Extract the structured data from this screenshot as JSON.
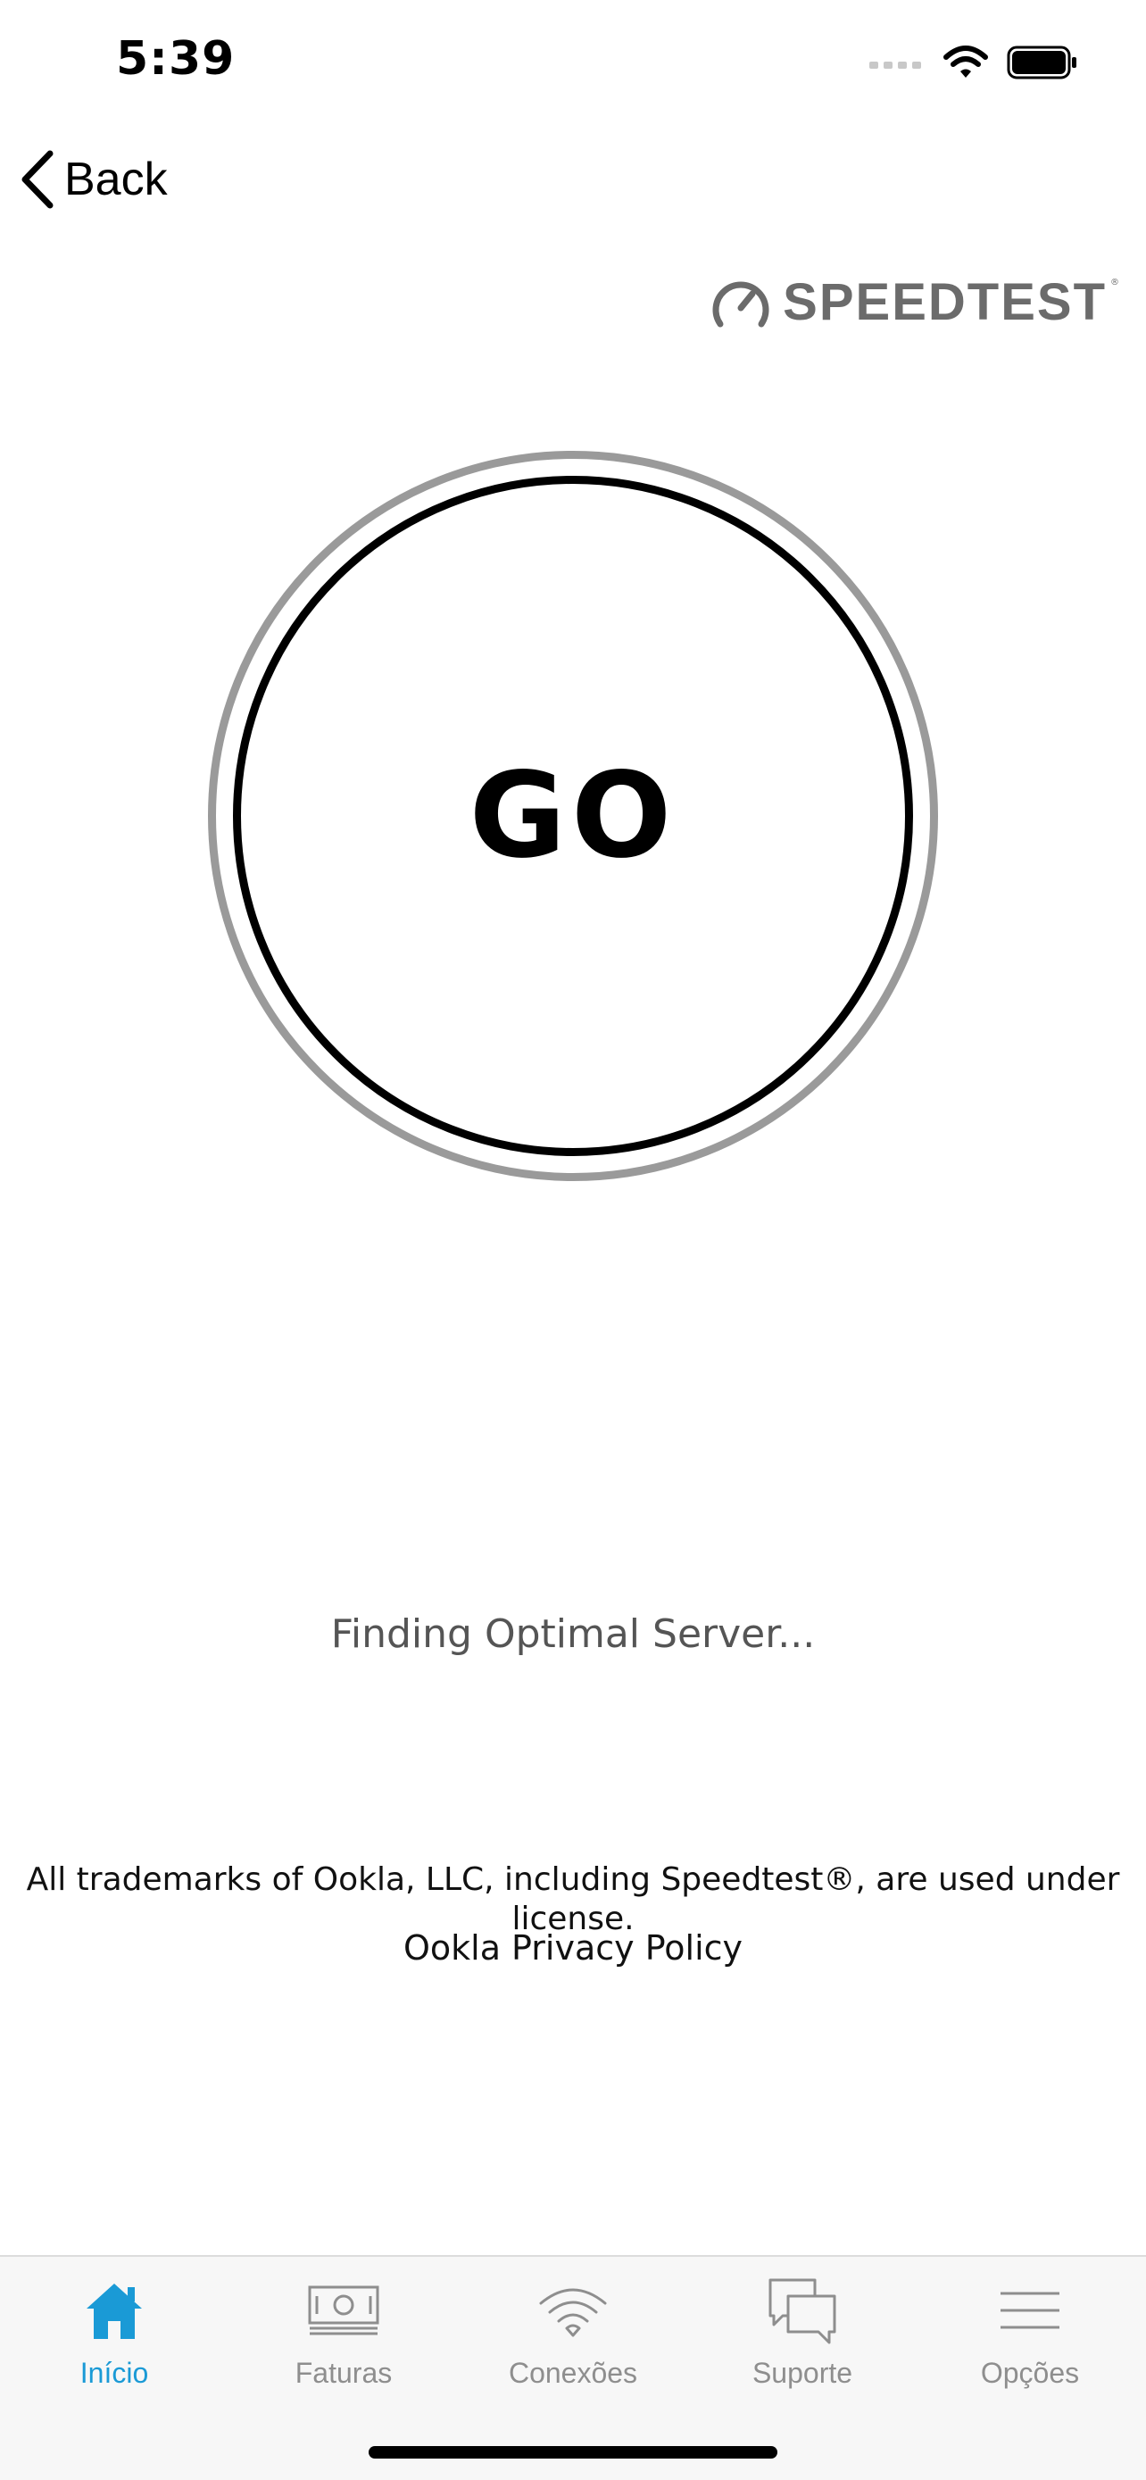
{
  "status_bar": {
    "time": "5:39"
  },
  "nav": {
    "back_label": "Back"
  },
  "logo": {
    "text": "SPEEDTEST"
  },
  "speedtest": {
    "go_label": "GO",
    "status": "Finding Optimal Server..."
  },
  "legal": {
    "trademark": "All trademarks of Ookla, LLC, including Speedtest®, are used under license.",
    "privacy": "Ookla Privacy Policy"
  },
  "tabbar": {
    "active_color": "#1a9ad6",
    "inactive_color": "#8e8e8e",
    "tabs": [
      {
        "label": "Início",
        "icon": "home-icon",
        "active": true
      },
      {
        "label": "Faturas",
        "icon": "bill-icon",
        "active": false
      },
      {
        "label": "Conexões",
        "icon": "wifi-icon",
        "active": false
      },
      {
        "label": "Suporte",
        "icon": "chat-icon",
        "active": false
      },
      {
        "label": "Opções",
        "icon": "menu-icon",
        "active": false
      }
    ]
  }
}
